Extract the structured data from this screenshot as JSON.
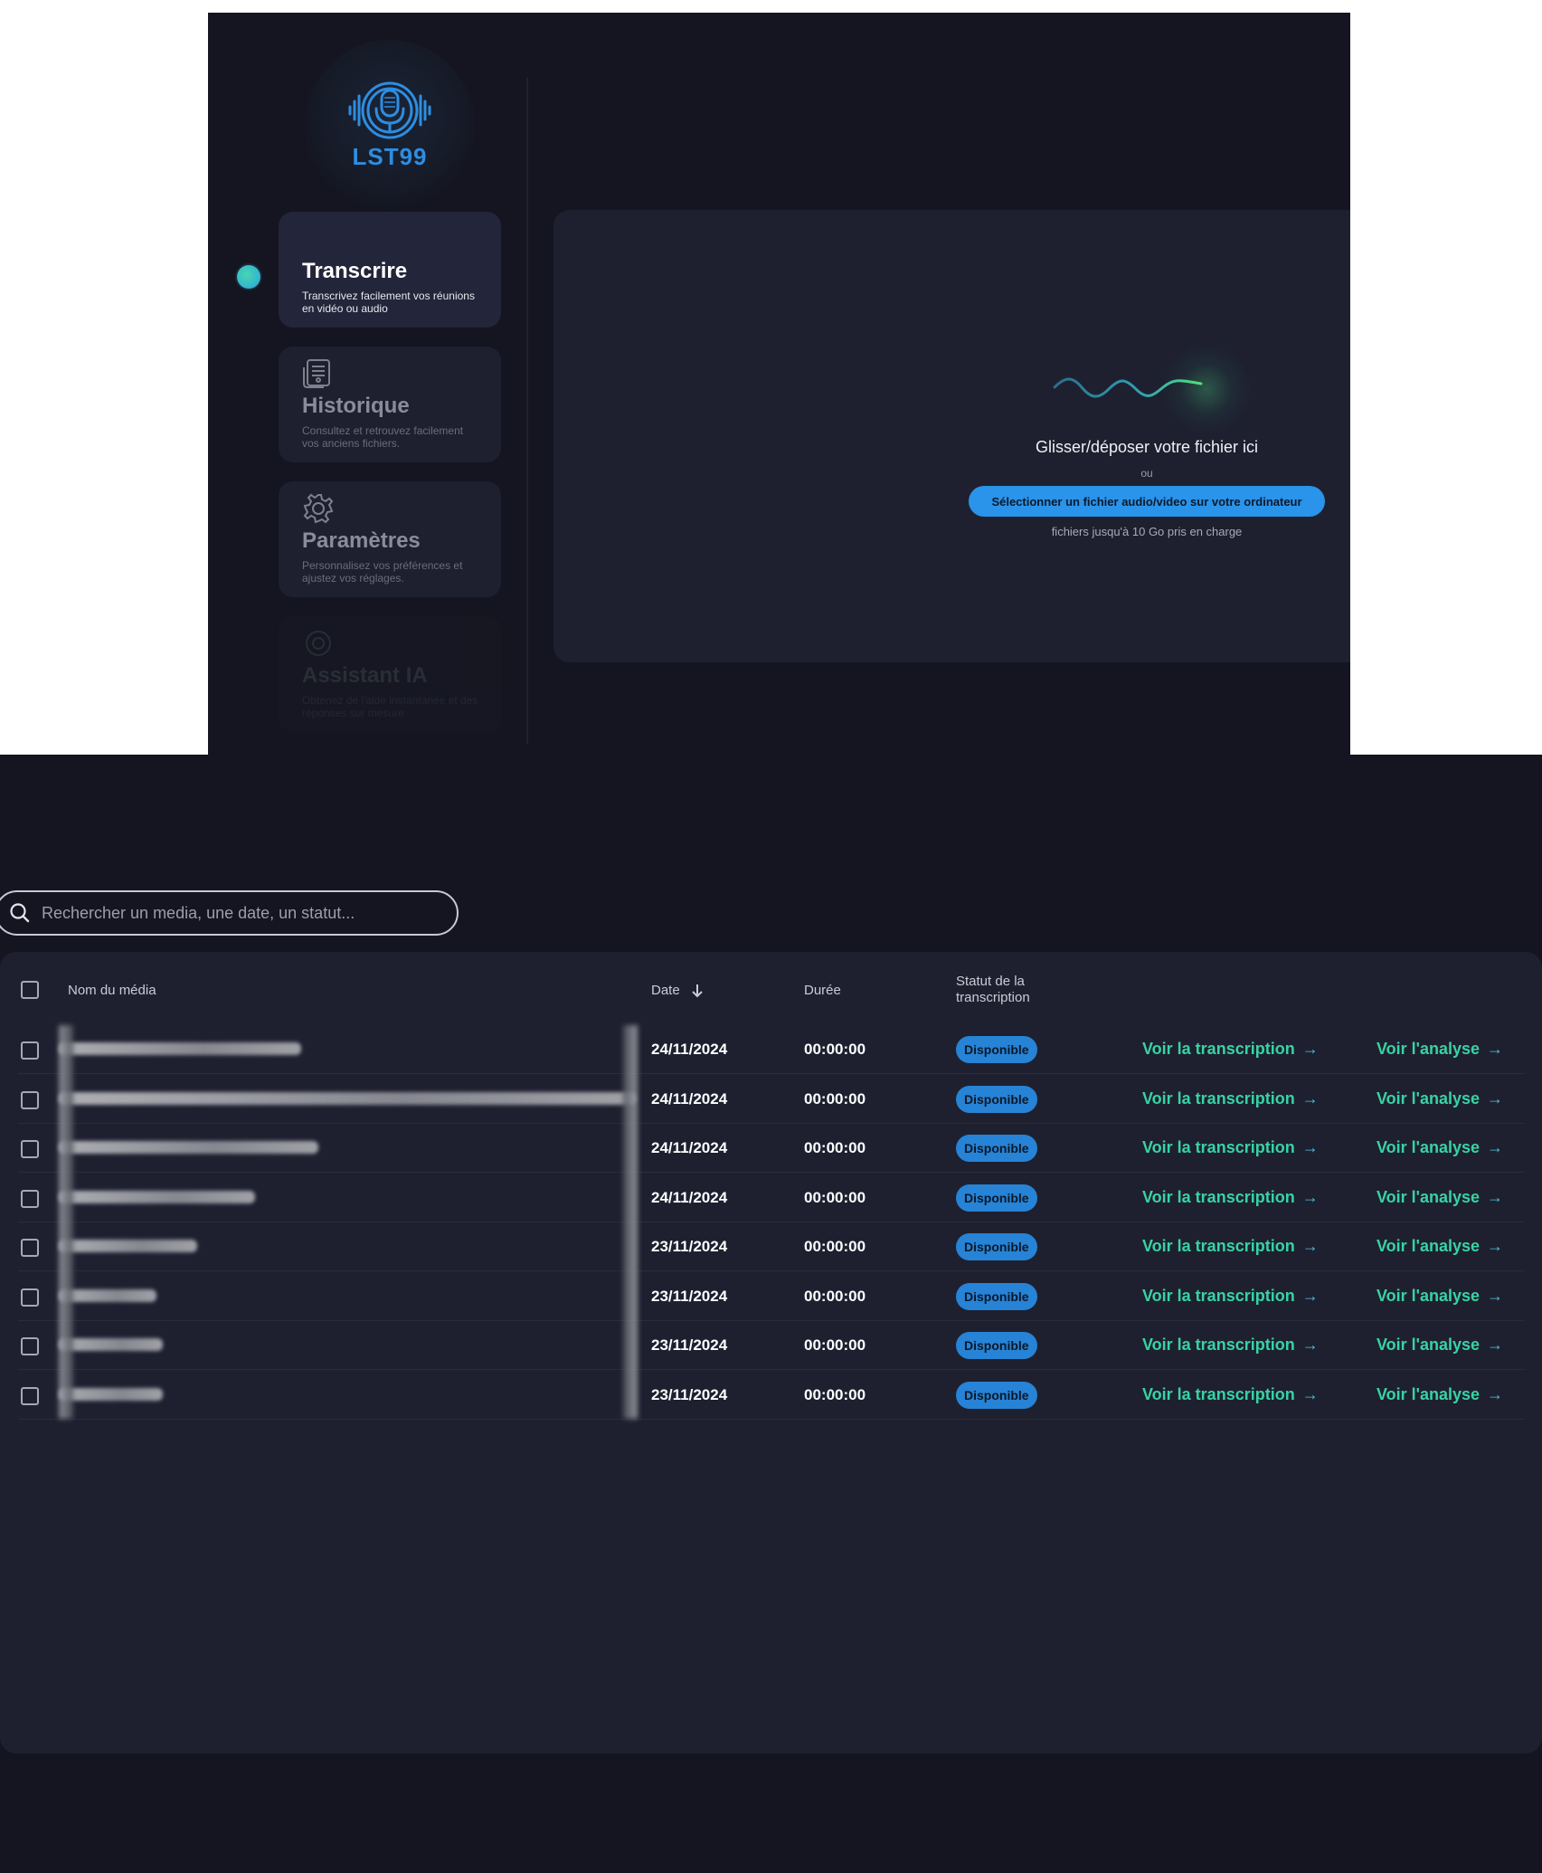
{
  "app": {
    "logo_text": "LST99",
    "accent": "#2e8de0"
  },
  "sidebar": {
    "items": [
      {
        "label": "Transcrire",
        "desc": "Transcrivez facilement vos réunions en vidéo ou audio",
        "icon": "waveform-icon",
        "active": true
      },
      {
        "label": "Historique",
        "desc": "Consultez et retrouvez facilement vos anciens fichiers.",
        "icon": "document-list-icon",
        "active": false
      },
      {
        "label": "Paramètres",
        "desc": "Personnalisez vos préférences et ajustez vos réglages.",
        "icon": "gear-icon",
        "active": false
      },
      {
        "label": "Assistant IA",
        "desc": "Obtenez de l'aide instantanée et des réponses sur mesure",
        "icon": "ai-gear-icon",
        "active": false
      }
    ]
  },
  "upload": {
    "drop_text": "Glisser/déposer votre fichier ici",
    "or_text": "ou",
    "select_button": "Sélectionner un fichier audio/video sur votre ordinateur",
    "note": "fichiers jusqu'à 10 Go pris en charge"
  },
  "history": {
    "search_placeholder": "Rechercher un media, une date, un statut...",
    "columns": {
      "name": "Nom du média",
      "date": "Date",
      "duration": "Durée",
      "status": "Statut de la transcription"
    },
    "rows": [
      {
        "date": "24/11/2024",
        "duration": "00:00:00",
        "status": "Disponible",
        "transcription_link": "Voir la transcription",
        "analysis_link": "Voir l'analyse",
        "name_redacted_width": 0.42
      },
      {
        "date": "24/11/2024",
        "duration": "00:00:00",
        "status": "Disponible",
        "transcription_link": "Voir la transcription",
        "analysis_link": "Voir l'analyse",
        "name_redacted_width": 1.0
      },
      {
        "date": "24/11/2024",
        "duration": "00:00:00",
        "status": "Disponible",
        "transcription_link": "Voir la transcription",
        "analysis_link": "Voir l'analyse",
        "name_redacted_width": 0.45
      },
      {
        "date": "24/11/2024",
        "duration": "00:00:00",
        "status": "Disponible",
        "transcription_link": "Voir la transcription",
        "analysis_link": "Voir l'analyse",
        "name_redacted_width": 0.34
      },
      {
        "date": "23/11/2024",
        "duration": "00:00:00",
        "status": "Disponible",
        "transcription_link": "Voir la transcription",
        "analysis_link": "Voir l'analyse",
        "name_redacted_width": 0.24
      },
      {
        "date": "23/11/2024",
        "duration": "00:00:00",
        "status": "Disponible",
        "transcription_link": "Voir la transcription",
        "analysis_link": "Voir l'analyse",
        "name_redacted_width": 0.17
      },
      {
        "date": "23/11/2024",
        "duration": "00:00:00",
        "status": "Disponible",
        "transcription_link": "Voir la transcription",
        "analysis_link": "Voir l'analyse",
        "name_redacted_width": 0.18
      },
      {
        "date": "23/11/2024",
        "duration": "00:00:00",
        "status": "Disponible",
        "transcription_link": "Voir la transcription",
        "analysis_link": "Voir l'analyse",
        "name_redacted_width": 0.18
      }
    ]
  },
  "colors": {
    "background": "#141520",
    "panel": "#1e2030",
    "link_green": "#38d3a3",
    "badge_blue": "#2683d6",
    "button_blue": "#2a93ea"
  }
}
